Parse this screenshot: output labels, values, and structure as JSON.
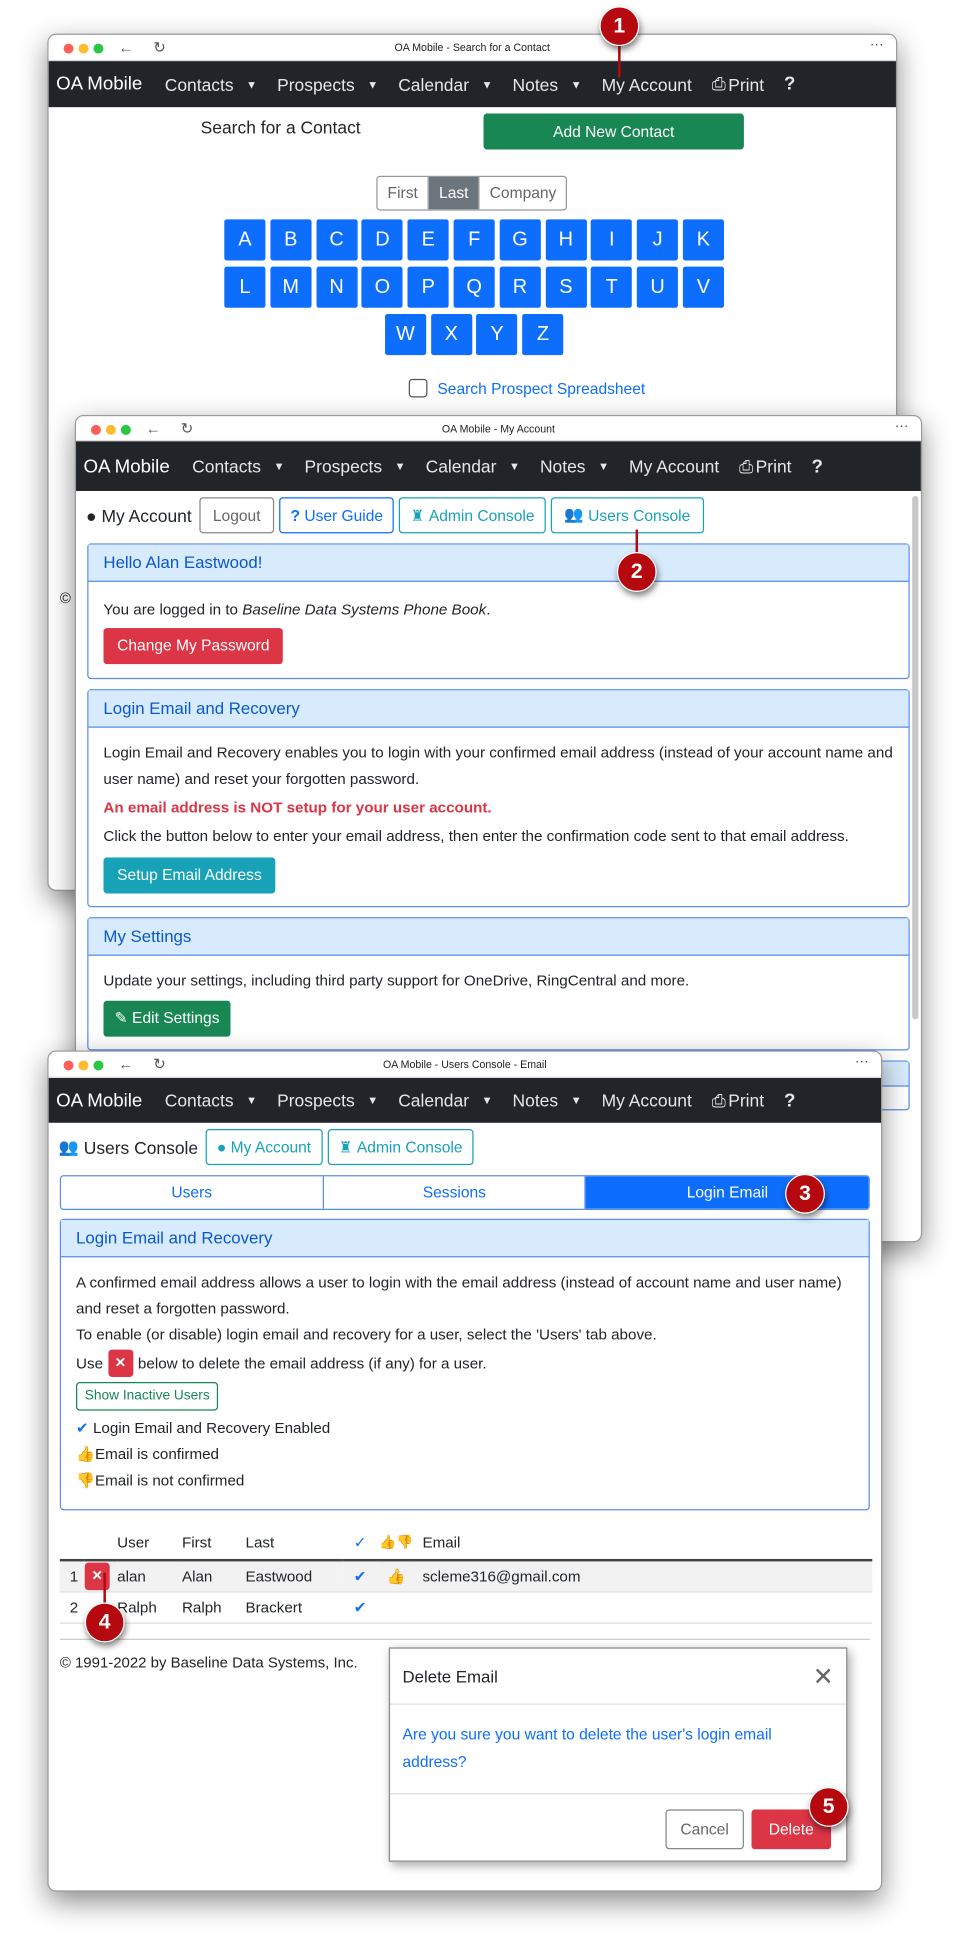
{
  "nav": {
    "brand": "OA Mobile",
    "items": [
      "Contacts",
      "Prospects",
      "Calendar",
      "Notes"
    ],
    "my_account": "My Account",
    "print": "Print",
    "help": "?"
  },
  "colors": {
    "primary": "#0d6efd",
    "success": "#198754",
    "danger": "#dc3545",
    "info": "#17a2b8",
    "navbar": "#212529",
    "badge": "#b5090f"
  },
  "search_window": {
    "title": "OA Mobile - Search for a Contact",
    "heading": "Search for a Contact",
    "add_button": "Add New Contact",
    "segments": [
      "First",
      "Last",
      "Company"
    ],
    "active_segment": "Last",
    "letters": [
      "A",
      "B",
      "C",
      "D",
      "E",
      "F",
      "G",
      "H",
      "I",
      "J",
      "K",
      "L",
      "M",
      "N",
      "O",
      "P",
      "Q",
      "R",
      "S",
      "T",
      "U",
      "V",
      "W",
      "X",
      "Y",
      "Z"
    ],
    "checkbox_label": "Search Prospect Spreadsheet",
    "footer_fragment": "©"
  },
  "account_window": {
    "title": "OA Mobile - My Account",
    "heading": "My Account",
    "buttons": {
      "logout": "Logout",
      "user_guide": "User Guide",
      "admin_console": "Admin Console",
      "users_console": "Users Console"
    },
    "hello_card": {
      "title": "Hello Alan Eastwood!",
      "text_prefix": "You are logged in to ",
      "text_company": "Baseline Data Systems Phone Book",
      "text_suffix": ".",
      "button": "Change My Password"
    },
    "login_card": {
      "title": "Login Email and Recovery",
      "text": "Login Email and Recovery enables you to login with your confirmed email address (instead of your account name and user name) and reset your forgotten password.",
      "warning": "An email address is NOT setup for your user account.",
      "instruction": "Click the button below to enter your email address, then enter the confirmation code sent to that email address.",
      "button": "Setup Email Address"
    },
    "settings_card": {
      "title": "My Settings",
      "text": "Update your settings, including third party support for OneDrive, RingCentral and more.",
      "button": "Edit Settings"
    }
  },
  "users_window": {
    "title": "OA Mobile - Users Console - Email",
    "heading": "Users Console",
    "buttons": {
      "my_account": "My Account",
      "admin_console": "Admin Console"
    },
    "tabs": [
      "Users",
      "Sessions",
      "Login Email"
    ],
    "active_tab": "Login Email",
    "card": {
      "title": "Login Email and Recovery",
      "text1": "A confirmed email address allows a user to login with the email address (instead of account name and user name) and reset a forgotten password.",
      "text2": "To enable (or disable) login email and recovery for a user, select the 'Users' tab above.",
      "use_prefix": "Use",
      "use_suffix": "below to delete the email address (if any) for a user.",
      "show_inactive": "Show Inactive Users",
      "legend_enabled": "Login Email and Recovery Enabled",
      "legend_confirmed": "Email is confirmed",
      "legend_not_confirmed": "Email is not confirmed"
    },
    "table": {
      "headers": [
        "",
        "",
        "User",
        "First",
        "Last",
        "✓",
        "",
        "Email"
      ],
      "rows": [
        {
          "num": "1",
          "user": "alan",
          "first": "Alan",
          "last": "Eastwood",
          "enabled": true,
          "confirmed": true,
          "email": "scleme316@gmail.com"
        },
        {
          "num": "2",
          "user": "Ralph",
          "first": "Ralph",
          "last": "Brackert",
          "enabled": true,
          "confirmed": false,
          "email": ""
        }
      ]
    },
    "footer": "© 1991-2022 by Baseline Data Systems, Inc."
  },
  "dialog": {
    "title": "Delete Email",
    "message": "Are you sure you want to delete the user's login email address?",
    "cancel": "Cancel",
    "delete": "Delete"
  },
  "step_badges": [
    "1",
    "2",
    "3",
    "4",
    "5"
  ]
}
